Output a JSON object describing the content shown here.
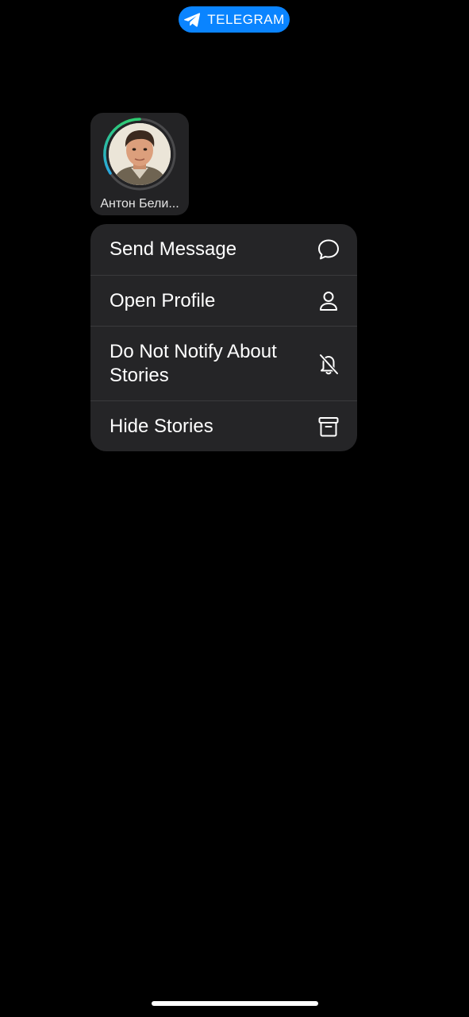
{
  "app_pill": {
    "label": "TELEGRAM",
    "icon": "paper-plane-icon",
    "color": "#0a84ff"
  },
  "story": {
    "name": "Антон Бели...",
    "ring_colors": [
      "#2ecc71",
      "#2aa8e0"
    ]
  },
  "menu": {
    "items": [
      {
        "label": "Send Message",
        "icon": "chat-bubble-icon"
      },
      {
        "label": "Open Profile",
        "icon": "person-icon"
      },
      {
        "label": "Do Not Notify About Stories",
        "icon": "bell-slash-icon"
      },
      {
        "label": "Hide Stories",
        "icon": "archive-box-icon"
      }
    ]
  }
}
